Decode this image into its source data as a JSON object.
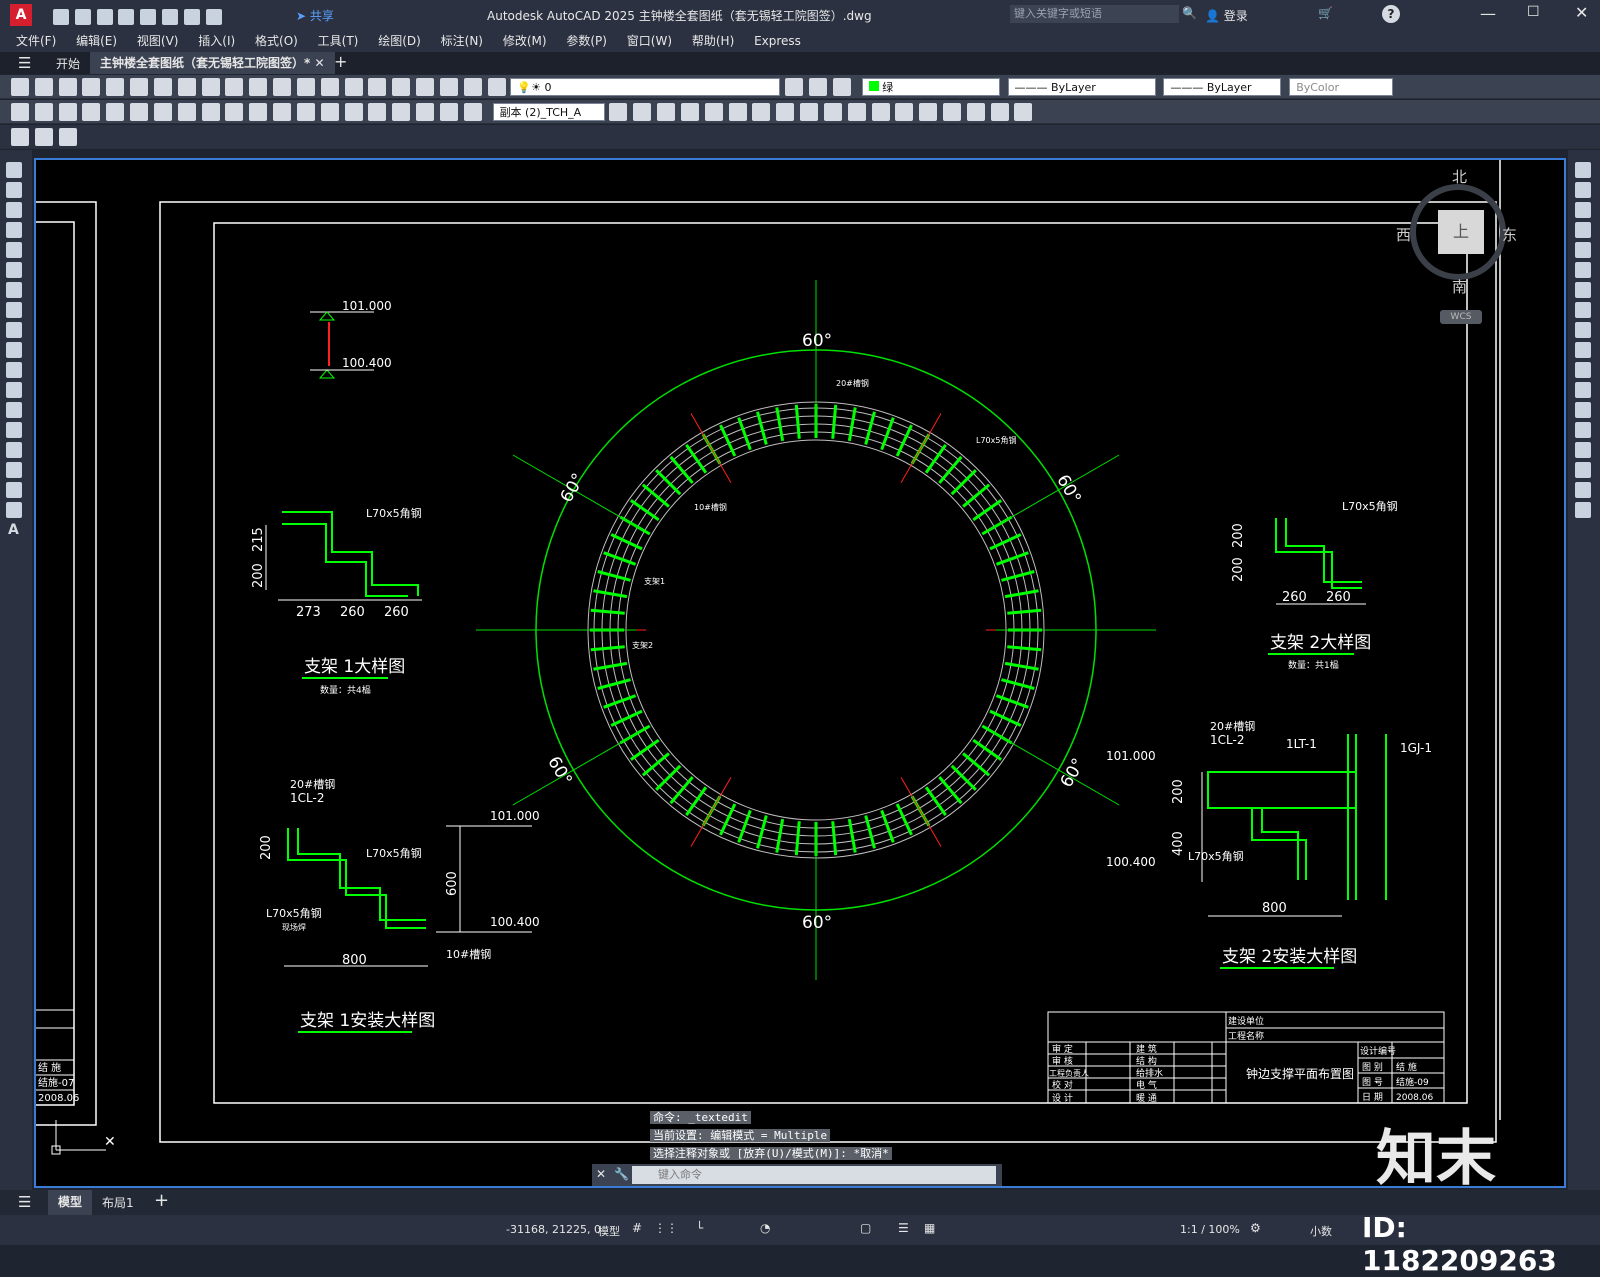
{
  "window": {
    "title": "Autodesk AutoCAD 2025    主钟楼全套图纸（套无锡轻工院图签）.dwg",
    "search_placeholder": "键入关键字或短语",
    "login_label": "登录",
    "share_label": "共享"
  },
  "menu": [
    "文件(F)",
    "编辑(E)",
    "视图(V)",
    "插入(I)",
    "格式(O)",
    "工具(T)",
    "绘图(D)",
    "标注(N)",
    "修改(M)",
    "参数(P)",
    "窗口(W)",
    "帮助(H)",
    "Express"
  ],
  "tabs": {
    "start": "开始",
    "active": "主钟楼全套图纸（套无锡轻工院图签）*"
  },
  "toolbar": {
    "layer_value": "0",
    "color_value": "绿",
    "linetype_value": "ByLayer",
    "lineweight_value": "ByLayer",
    "plotstyle_value": "ByColor",
    "textstyle_value": "副本 (2)_TCH_A"
  },
  "viewcube": {
    "north": "北",
    "south": "南",
    "east": "东",
    "west": "西",
    "top": "上",
    "wcs": "WCS"
  },
  "drawing": {
    "ring_angles": [
      "60°",
      "60°",
      "60°",
      "60°",
      "60°",
      "60°"
    ],
    "ring_notes": [
      "20#槽钢",
      "L70x5角钢",
      "10#槽钢",
      "支架1",
      "支架2"
    ],
    "elev_top": "101.000",
    "elev_bottom": "100.400",
    "d1_title": "支架 1大样图",
    "d1_sub": "数量：共4榀",
    "d1_dims": [
      "273",
      "260",
      "260"
    ],
    "d1_vdims": [
      "215",
      "200"
    ],
    "d1_steel": "L70x5角钢",
    "d2_title": "支架 2大样图",
    "d2_sub": "数量：共1榀",
    "d2_dims": [
      "260",
      "260"
    ],
    "d2_vdims": [
      "200",
      "200"
    ],
    "d2_steel": "L70x5角钢",
    "d3_title": "支架 1安装大样图",
    "d3_labels": [
      "20#槽钢",
      "1CL-2",
      "L70x5角钢",
      "L70x5角钢",
      "现场焊",
      "10#槽钢"
    ],
    "d3_dims": [
      "800",
      "600",
      "200"
    ],
    "d3_elev_top": "101.000",
    "d3_elev_bottom": "100.400",
    "d4_title": "支架 2安装大样图",
    "d4_labels": [
      "20#槽钢",
      "1CL-2",
      "1LT-1",
      "1GJ-1",
      "L70x5角钢"
    ],
    "d4_dims": [
      "800",
      "200",
      "400"
    ],
    "d4_elev_top": "101.000",
    "d4_elev_bottom": "100.400"
  },
  "titleblock": {
    "unit": "建设单位",
    "project": "工程名称",
    "drawing_name": "钟边支撑平面布置图",
    "rows_left": [
      "审 定",
      "审 核",
      "工程负责人",
      "校 对",
      "设 计"
    ],
    "rows_mid": [
      "建 筑",
      "结 构",
      "给排水",
      "电 气",
      "暖 通"
    ],
    "right_keys": [
      "设计编号",
      "图 别",
      "图 号",
      "日 期"
    ],
    "right_vals": [
      "",
      "结 施",
      "结施-09",
      "2008.06"
    ],
    "left_stub": [
      "结 施",
      "结施-07",
      "2008.06"
    ]
  },
  "command": {
    "line1": "命令: _textedit",
    "line2": "当前设置: 编辑模式 = Multiple",
    "line3": "选择注释对象或 [放弃(U)/模式(M)]: *取消*",
    "placeholder": "键入命令"
  },
  "layouts": [
    "模型",
    "布局1"
  ],
  "status": {
    "coords": "-31168, 21225, 0",
    "mode": "模型",
    "scale": "1:1 / 100%",
    "units": "小数"
  },
  "watermark": {
    "brand": "知末",
    "id": "ID: 1182209263"
  },
  "colors": {
    "green": "#00ff00",
    "red": "#ff2020",
    "cyan": "#00e0ff",
    "white": "#ffffff",
    "accent": "#3a7bd5"
  }
}
